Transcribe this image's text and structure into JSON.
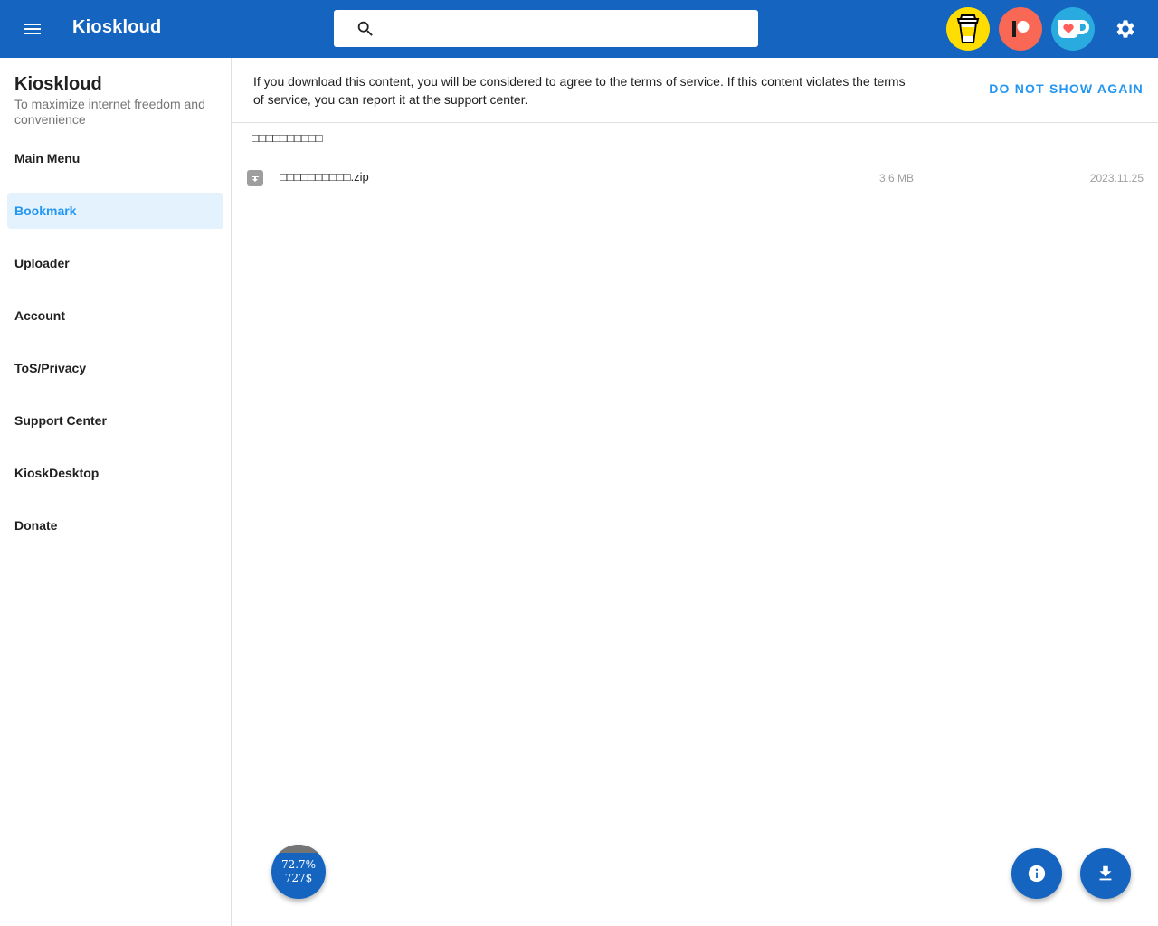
{
  "header": {
    "app_title": "Kioskloud",
    "search": {
      "placeholder": "",
      "value": ""
    },
    "icons": [
      "menu-icon",
      "search-icon",
      "buymeacoffee-icon",
      "patreon-icon",
      "kofi-icon",
      "settings-icon"
    ]
  },
  "sidebar": {
    "title": "Kioskloud",
    "subtitle": "To maximize internet freedom and convenience",
    "items": [
      {
        "label": "Main Menu",
        "active": false
      },
      {
        "label": "Bookmark",
        "active": true
      },
      {
        "label": "Uploader",
        "active": false
      },
      {
        "label": "Account",
        "active": false
      },
      {
        "label": "ToS/Privacy",
        "active": false
      },
      {
        "label": "Support Center",
        "active": false
      },
      {
        "label": "KioskDesktop",
        "active": false
      },
      {
        "label": "Donate",
        "active": false
      }
    ]
  },
  "notice": {
    "text": "If you download this content, you will be considered to agree to the terms of service. If this content violates the terms of service, you can report it at the support center.",
    "dismiss_label": "DO NOT SHOW AGAIN"
  },
  "content": {
    "folder_name": "□□□□□□□□□□",
    "files": [
      {
        "name": "□□□□□□□□□□.zip",
        "size": "3.6 MB",
        "date": "2023.11.25"
      }
    ]
  },
  "quota": {
    "percent_text": "72.7%",
    "amount_text": "727$",
    "fraction": 0.727
  },
  "colors": {
    "primary": "#1565c0",
    "accent": "#2196f3",
    "active_bg": "#e3f2fd"
  }
}
